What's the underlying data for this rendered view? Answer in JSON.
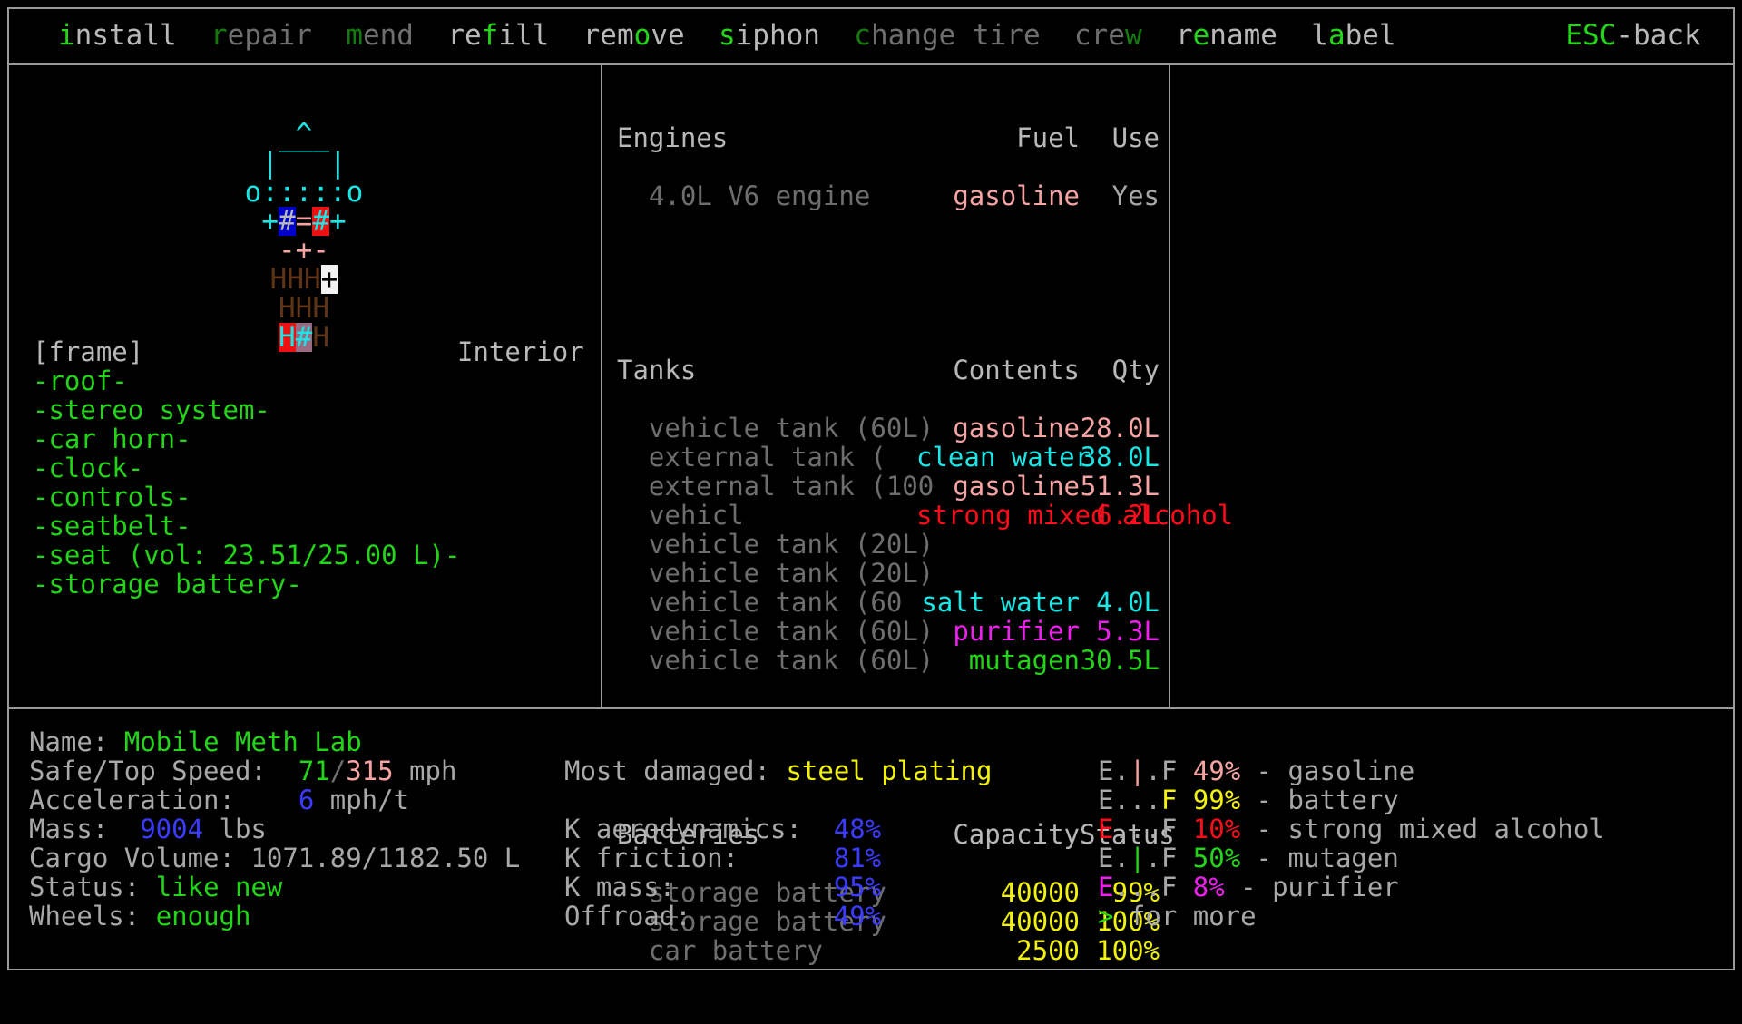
{
  "menu": {
    "items": [
      {
        "name": "install",
        "hot": "i",
        "hot_index": 0,
        "enabled": true
      },
      {
        "name": "repair",
        "hot": "r",
        "hot_index": 0,
        "enabled": false
      },
      {
        "name": "mend",
        "hot": "m",
        "hot_index": 0,
        "enabled": false
      },
      {
        "name": "refill",
        "hot": "f",
        "hot_index": 2,
        "enabled": true
      },
      {
        "name": "remove",
        "hot": "o",
        "hot_index": 3,
        "enabled": true
      },
      {
        "name": "siphon",
        "hot": "s",
        "hot_index": 0,
        "enabled": true
      },
      {
        "name": "change tire",
        "hot": "c",
        "hot_index": 0,
        "enabled": false
      },
      {
        "name": "crew",
        "hot": "w",
        "hot_index": 3,
        "enabled": false
      },
      {
        "name": "rename",
        "hot": "e",
        "hot_index": 1,
        "enabled": true
      },
      {
        "name": "label",
        "hot": "a",
        "hot_index": 1,
        "enabled": true
      }
    ],
    "back_key": "ESC",
    "back_label": "-back"
  },
  "vehicle_art": {
    "rows": [
      [
        {
          "t": "   ^   ",
          "fg": "cyan"
        }
      ],
      [
        {
          "t": " |‾‾‾| ",
          "fg": "cyan"
        }
      ],
      [
        {
          "t": "o:::::o",
          "fg": "cyan"
        }
      ],
      [
        {
          "t": "+",
          "fg": "cyan"
        },
        {
          "t": "#",
          "fg": "white",
          "bg": "blue"
        },
        {
          "t": "=",
          "fg": "ltred"
        },
        {
          "t": "#",
          "fg": "cyan",
          "bg": "red"
        },
        {
          "t": "+",
          "fg": "cyan"
        }
      ],
      [
        {
          "t": " -+- ",
          "fg": "ltred"
        }
      ],
      [
        {
          "t": "HHH",
          "fg": "brown"
        },
        {
          "t": "+",
          "fg": "black",
          "bg": "white"
        }
      ],
      [
        {
          "t": "HHH",
          "fg": "brown"
        }
      ],
      [
        {
          "t": "H",
          "fg": "cyan",
          "bg": "red"
        },
        {
          "t": "#",
          "fg": "cyan",
          "bg": "mauve"
        },
        {
          "t": "H",
          "fg": "brown"
        }
      ]
    ]
  },
  "left": {
    "interior_label": "Interior",
    "parts": [
      {
        "text": "[frame]",
        "color": "white"
      },
      {
        "text": "-roof-",
        "color": "green"
      },
      {
        "text": "-stereo system-",
        "color": "green"
      },
      {
        "text": "-car horn-",
        "color": "green"
      },
      {
        "text": "-clock-",
        "color": "green"
      },
      {
        "text": "-controls-",
        "color": "green"
      },
      {
        "text": "-seatbelt-",
        "color": "green"
      },
      {
        "text": "-seat (vol: 23.51/25.00 L)-",
        "color": "green"
      },
      {
        "text": "-storage battery-",
        "color": "green"
      }
    ]
  },
  "mid": {
    "engines": {
      "header": {
        "title": "Engines",
        "col2": "Fuel",
        "col3": "Use"
      },
      "rows": [
        {
          "name": "4.0L V6 engine",
          "name_color": "dkgray",
          "fuel": "gasoline",
          "fuel_color": "ltred",
          "use": "Yes",
          "use_color": "gray"
        }
      ]
    },
    "tanks": {
      "header": {
        "title": "Tanks",
        "col2": "Contents",
        "col3": "Qty"
      },
      "rows": [
        {
          "name": "vehicle tank (60L)",
          "contents": "gasoline",
          "contents_color": "ltred",
          "qty": "28.0L",
          "qty_color": "ltred"
        },
        {
          "name": "external tank (",
          "contents": "clean water",
          "contents_color": "cyan",
          "qty": "38.0L",
          "qty_color": "cyan"
        },
        {
          "name": "external tank (100",
          "contents": "gasoline",
          "contents_color": "ltred",
          "qty": "51.3L",
          "qty_color": "ltred"
        },
        {
          "name": "vehicl",
          "contents": "strong mixed alcohol",
          "contents_color": "red",
          "qty": "6.2L",
          "qty_color": "red"
        },
        {
          "name": "vehicle tank (20L)",
          "contents": "",
          "contents_color": "gray",
          "qty": "",
          "qty_color": "gray"
        },
        {
          "name": "vehicle tank (20L)",
          "contents": "",
          "contents_color": "gray",
          "qty": "",
          "qty_color": "gray"
        },
        {
          "name": "vehicle tank (60",
          "contents": "salt water",
          "contents_color": "cyan",
          "qty": "4.0L",
          "qty_color": "cyan"
        },
        {
          "name": "vehicle tank (60L)",
          "contents": "purifier",
          "contents_color": "magenta",
          "qty": "5.3L",
          "qty_color": "magenta"
        },
        {
          "name": "vehicle tank (60L)",
          "contents": "mutagen",
          "contents_color": "green",
          "qty": "30.5L",
          "qty_color": "green"
        }
      ]
    },
    "batteries": {
      "header": {
        "title": "Batteries",
        "col2": "Capacity",
        "col3": "Status"
      },
      "rows": [
        {
          "name": "storage battery",
          "capacity": "40000",
          "status": "99%"
        },
        {
          "name": "storage battery",
          "capacity": "40000",
          "status": "100%"
        },
        {
          "name": "car battery",
          "capacity": "2500",
          "status": "100%"
        }
      ]
    }
  },
  "bottom": {
    "col1": [
      {
        "label": "Name: ",
        "value": "Mobile Meth Lab",
        "value_color": "green"
      },
      {
        "label": "Safe/Top Speed:  ",
        "value": "71",
        "value_color": "green",
        "sep": "/",
        "sep_color": "dkgray",
        "value2": "315",
        "value2_color": "ltred",
        "suffix": " mph"
      },
      {
        "label": "Acceleration:    ",
        "value": "6",
        "value_color": "blue",
        "suffix": " mph/t"
      },
      {
        "label": "Mass:  ",
        "value": "9004",
        "value_color": "blue",
        "suffix": " lbs"
      },
      {
        "label": "Cargo Volume: 1071.89/1182.50 L",
        "value": "",
        "value_color": "gray"
      },
      {
        "label": "Status: ",
        "value": "like new",
        "value_color": "green"
      },
      {
        "label": "Wheels: ",
        "value": "enough",
        "value_color": "green"
      }
    ],
    "col2": [
      {
        "label": "Most damaged: ",
        "value": "steel plating",
        "value_color": "yellow"
      },
      {
        "label": "",
        "value": "",
        "value_color": "gray"
      },
      {
        "label": "K aerodynamics:  ",
        "value": "48%",
        "value_color": "blue"
      },
      {
        "label": "K friction:      ",
        "value": "81%",
        "value_color": "blue"
      },
      {
        "label": "K mass:          ",
        "value": "95%",
        "value_color": "blue"
      },
      {
        "label": "Offroad:         ",
        "value": "49%",
        "value_color": "blue"
      }
    ],
    "gauges": [
      {
        "gauge": "E.|.F",
        "fill_index": 2,
        "pct": "49%",
        "color": "ltred",
        "label": "- gasoline"
      },
      {
        "gauge": "E...F",
        "fill_index": 4,
        "pct": "99%",
        "color": "yellow",
        "label": "- battery"
      },
      {
        "gauge": "E...F",
        "fill_index": 0,
        "pct": "10%",
        "color": "red",
        "label": "- strong mixed alcohol"
      },
      {
        "gauge": "E.|.F",
        "fill_index": 2,
        "pct": "50%",
        "color": "green",
        "label": "- mutagen"
      },
      {
        "gauge": "E...F",
        "fill_index": 0,
        "pct": "8%",
        "color": "magenta",
        "label": "- purifier"
      }
    ],
    "more_key": ">",
    "more_label": " for more"
  }
}
